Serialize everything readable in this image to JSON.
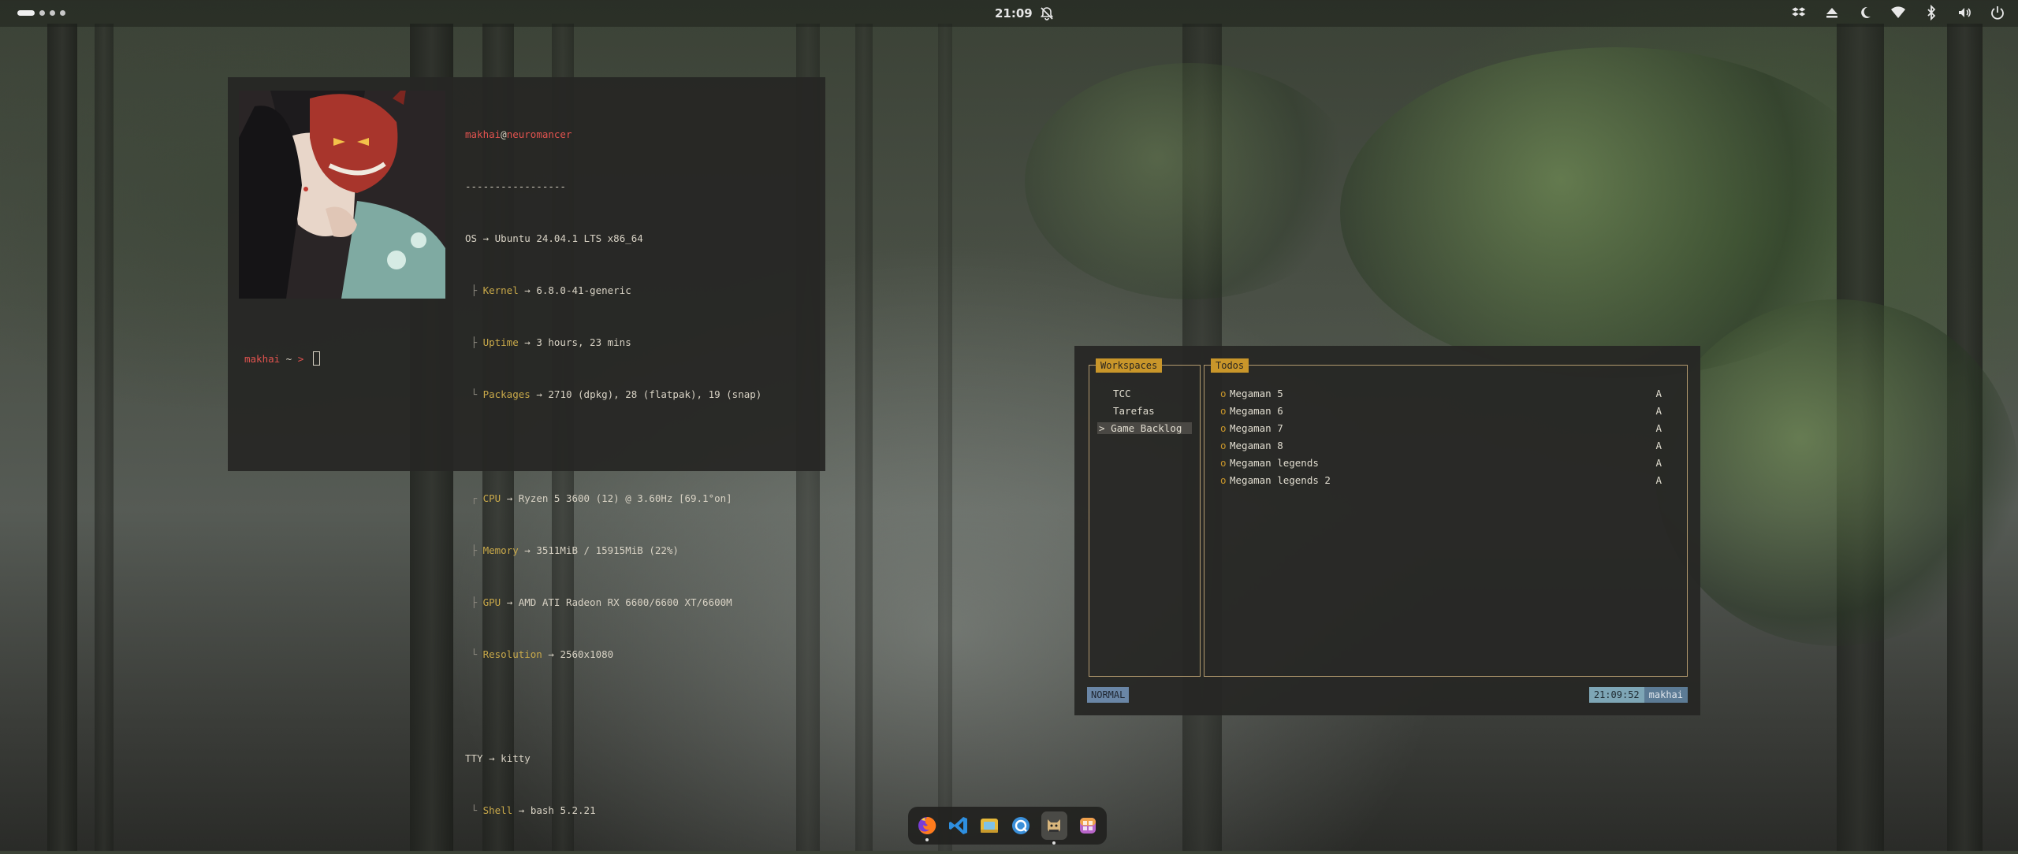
{
  "topbar": {
    "clock": "21:09",
    "icons": [
      "notifications-off-icon",
      "dropbox-icon",
      "eject-icon",
      "night-light-icon",
      "wifi-icon",
      "bluetooth-icon",
      "volume-icon",
      "power-icon"
    ]
  },
  "fetch": {
    "user": "makhai",
    "at": "@",
    "host": "neuromancer",
    "separator": "-----------------",
    "os_key": "OS",
    "os_val": "Ubuntu 24.04.1 LTS x86_64",
    "kernel_key": "Kernel",
    "kernel_val": "6.8.0-41-generic",
    "uptime_key": "Uptime",
    "uptime_val": "3 hours, 23 mins",
    "packages_key": "Packages",
    "packages_val": "2710 (dpkg), 28 (flatpak), 19 (snap)",
    "cpu_key": "CPU",
    "cpu_val": "Ryzen 5 3600 (12) @ 3.60Hz [69.1°on]",
    "memory_key": "Memory",
    "memory_val": "3511MiB / 15915MiB (22%)",
    "gpu_key": "GPU",
    "gpu_val": "AMD ATI Radeon RX 6600/6600 XT/6600M",
    "resolution_key": "Resolution",
    "resolution_val": "2560x1080",
    "tty_key": "TTY",
    "tty_val": "kitty",
    "shell_key": "Shell",
    "shell_val": "bash 5.2.21",
    "arrow": "→"
  },
  "prompt": {
    "user": "makhai",
    "path": " ~ ",
    "symbol": "> "
  },
  "todo_app": {
    "workspaces_title": "Workspaces",
    "todos_title": "Todos",
    "workspaces": [
      "TCC",
      "Tarefas",
      "Game Backlog"
    ],
    "selected_marker": ">",
    "todos": [
      {
        "bullet": "o",
        "name": "Megaman 5",
        "flag": "A"
      },
      {
        "bullet": "o",
        "name": "Megaman 6",
        "flag": "A"
      },
      {
        "bullet": "o",
        "name": "Megaman 7",
        "flag": "A"
      },
      {
        "bullet": "o",
        "name": "Megaman 8",
        "flag": "A"
      },
      {
        "bullet": "o",
        "name": "Megaman legends",
        "flag": "A"
      },
      {
        "bullet": "o",
        "name": "Megaman legends 2",
        "flag": "A"
      }
    ],
    "mode": "NORMAL",
    "time": "21:09:52",
    "user": "makhai"
  },
  "dock": [
    "firefox-icon",
    "vscode-icon",
    "files-icon",
    "chat-icon",
    "terminal-cat-icon",
    "app-grid-icon"
  ]
}
